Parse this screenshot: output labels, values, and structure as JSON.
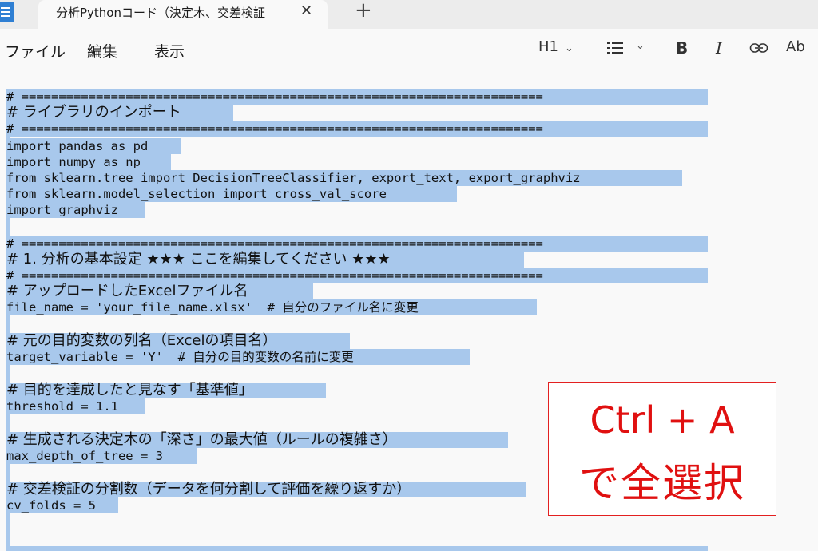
{
  "window": {
    "tab_title": "分析Pythonコード（決定木、交差検証",
    "tab_close": "✕",
    "new_tab": "+"
  },
  "menu": {
    "file": "ファイル",
    "edit": "編集",
    "view": "表示"
  },
  "toolbar": {
    "heading": "H1",
    "bold": "B",
    "italic": "I",
    "spell": "Ab",
    "chevron": "⌄"
  },
  "editor": {
    "lines": [
      "# ======================================================================",
      "# ライブラリのインポート",
      "# ======================================================================",
      "import pandas as pd",
      "import numpy as np",
      "from sklearn.tree import DecisionTreeClassifier, export_text, export_graphviz",
      "from sklearn.model_selection import cross_val_score",
      "import graphviz",
      "",
      "# ======================================================================",
      "# 1. 分析の基本設定 ★★★ ここを編集してください ★★★",
      "# ======================================================================",
      "# アップロードしたExcelファイル名",
      "file_name = 'your_file_name.xlsx'  # 自分のファイル名に変更",
      "",
      "# 元の目的変数の列名（Excelの項目名）",
      "target_variable = 'Y'  # 自分の目的変数の名前に変更",
      "",
      "# 目的を達成したと見なす「基準値」",
      "threshold = 1.1",
      "",
      "# 生成される決定木の「深さ」の最大値（ルールの複雑さ）",
      "max_depth_of_tree = 3",
      "",
      "# 交差検証の分割数（データを何分割して評価を繰り返すか）",
      "cv_folds = 5"
    ]
  },
  "annotation": {
    "line1": "Ctrl + A",
    "line2": "で全選択",
    "color": "#e01010"
  },
  "colors": {
    "selection": "#a8c8ec",
    "background": "#f9f9f9"
  }
}
